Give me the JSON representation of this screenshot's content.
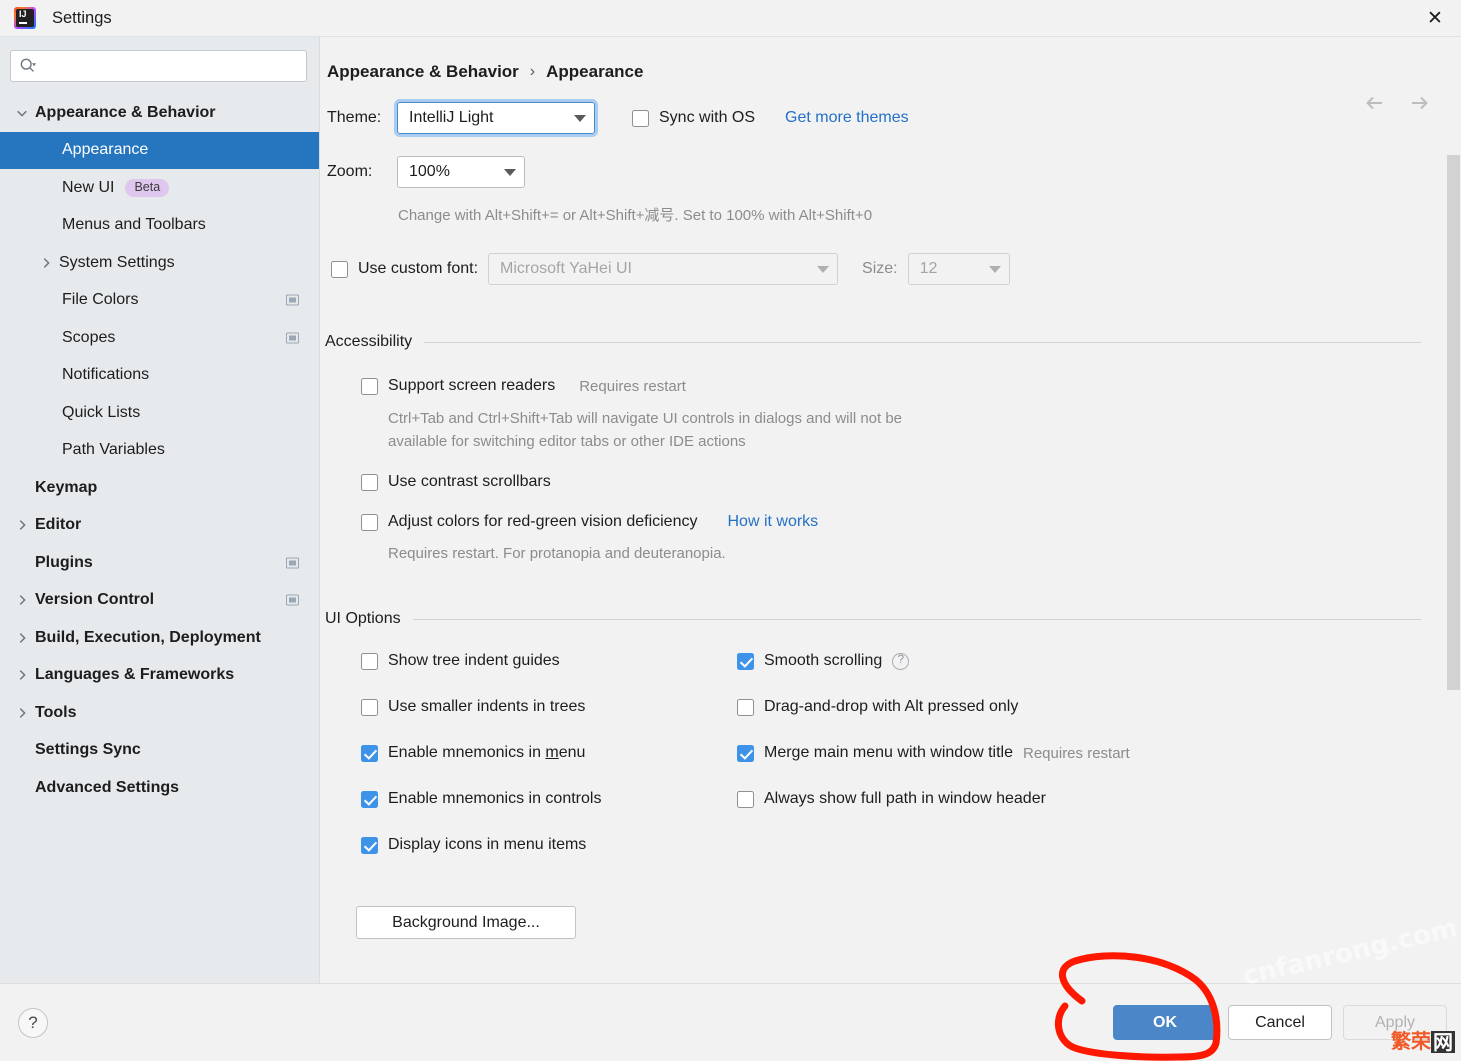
{
  "window": {
    "title": "Settings",
    "app_icon": "intellij-idea-icon",
    "close_icon": "close-icon"
  },
  "sidebar": {
    "search": {
      "value": "",
      "placeholder": "",
      "icon": "search-icon"
    },
    "items": [
      {
        "label": "Appearance & Behavior",
        "level": 0,
        "bold": true,
        "arrow": "down",
        "selected": false,
        "badge": "",
        "proj": false
      },
      {
        "label": "Appearance",
        "level": 1,
        "bold": false,
        "arrow": "",
        "selected": true,
        "badge": "",
        "proj": false
      },
      {
        "label": "New UI",
        "level": 1,
        "bold": false,
        "arrow": "",
        "selected": false,
        "badge": "Beta",
        "proj": false
      },
      {
        "label": "Menus and Toolbars",
        "level": 1,
        "bold": false,
        "arrow": "",
        "selected": false,
        "badge": "",
        "proj": false
      },
      {
        "label": "System Settings",
        "level": 1,
        "bold": false,
        "arrow": "right",
        "selected": false,
        "badge": "",
        "proj": false
      },
      {
        "label": "File Colors",
        "level": 1,
        "bold": false,
        "arrow": "",
        "selected": false,
        "badge": "",
        "proj": true
      },
      {
        "label": "Scopes",
        "level": 1,
        "bold": false,
        "arrow": "",
        "selected": false,
        "badge": "",
        "proj": true
      },
      {
        "label": "Notifications",
        "level": 1,
        "bold": false,
        "arrow": "",
        "selected": false,
        "badge": "",
        "proj": false
      },
      {
        "label": "Quick Lists",
        "level": 1,
        "bold": false,
        "arrow": "",
        "selected": false,
        "badge": "",
        "proj": false
      },
      {
        "label": "Path Variables",
        "level": 1,
        "bold": false,
        "arrow": "",
        "selected": false,
        "badge": "",
        "proj": false
      },
      {
        "label": "Keymap",
        "level": 0,
        "bold": true,
        "arrow": "",
        "selected": false,
        "badge": "",
        "proj": false
      },
      {
        "label": "Editor",
        "level": 0,
        "bold": true,
        "arrow": "right",
        "selected": false,
        "badge": "",
        "proj": false
      },
      {
        "label": "Plugins",
        "level": 0,
        "bold": true,
        "arrow": "",
        "selected": false,
        "badge": "",
        "proj": true
      },
      {
        "label": "Version Control",
        "level": 0,
        "bold": true,
        "arrow": "right",
        "selected": false,
        "badge": "",
        "proj": true
      },
      {
        "label": "Build, Execution, Deployment",
        "level": 0,
        "bold": true,
        "arrow": "right",
        "selected": false,
        "badge": "",
        "proj": false
      },
      {
        "label": "Languages & Frameworks",
        "level": 0,
        "bold": true,
        "arrow": "right",
        "selected": false,
        "badge": "",
        "proj": false
      },
      {
        "label": "Tools",
        "level": 0,
        "bold": true,
        "arrow": "right",
        "selected": false,
        "badge": "",
        "proj": false
      },
      {
        "label": "Settings Sync",
        "level": 0,
        "bold": true,
        "arrow": "",
        "selected": false,
        "badge": "",
        "proj": false
      },
      {
        "label": "Advanced Settings",
        "level": 0,
        "bold": true,
        "arrow": "",
        "selected": false,
        "badge": "",
        "proj": false
      }
    ]
  },
  "main": {
    "breadcrumb": {
      "parent": "Appearance & Behavior",
      "separator": "›",
      "current": "Appearance"
    },
    "nav": {
      "back_icon": "arrow-left-icon",
      "forward_icon": "arrow-right-icon"
    },
    "theme": {
      "label": "Theme:",
      "value": "IntelliJ Light",
      "sync_label": "Sync with OS",
      "sync_checked": false,
      "more_themes_link": "Get more themes"
    },
    "zoom": {
      "label": "Zoom:",
      "value": "100%",
      "hint": "Change with Alt+Shift+= or Alt+Shift+减号. Set to 100% with Alt+Shift+0"
    },
    "custom_font": {
      "label": "Use custom font:",
      "checked": false,
      "font_value": "Microsoft YaHei UI",
      "size_label": "Size:",
      "size_value": "12"
    },
    "accessibility": {
      "title": "Accessibility",
      "screen_readers": {
        "label": "Support screen readers",
        "note": "Requires restart",
        "checked": false
      },
      "screen_readers_desc_1": "Ctrl+Tab and Ctrl+Shift+Tab will navigate UI controls in dialogs and will not be",
      "screen_readers_desc_2": "available for switching editor tabs or other IDE actions",
      "contrast_scrollbars": {
        "label": "Use contrast scrollbars",
        "checked": false
      },
      "red_green": {
        "label": "Adjust colors for red-green vision deficiency",
        "checked": false,
        "link": "How it works"
      },
      "red_green_desc": "Requires restart. For protanopia and deuteranopia."
    },
    "ui_options": {
      "title": "UI Options",
      "left": [
        {
          "label": "Show tree indent guides",
          "checked": false,
          "mnemonic": ""
        },
        {
          "label": "Use smaller indents in trees",
          "checked": false,
          "mnemonic": ""
        },
        {
          "label": "Enable mnemonics in menu",
          "checked": true,
          "mnemonic": "m"
        },
        {
          "label": "Enable mnemonics in controls",
          "checked": true,
          "mnemonic": ""
        },
        {
          "label": "Display icons in menu items",
          "checked": true,
          "mnemonic": ""
        }
      ],
      "right": [
        {
          "label": "Smooth scrolling",
          "checked": true,
          "help": true,
          "note": ""
        },
        {
          "label": "Drag-and-drop with Alt pressed only",
          "checked": false,
          "help": false,
          "note": ""
        },
        {
          "label": "Merge main menu with window title",
          "checked": true,
          "help": false,
          "note": "Requires restart"
        },
        {
          "label": "Always show full path in window header",
          "checked": false,
          "help": false,
          "note": ""
        }
      ],
      "background_image_button": "Background Image..."
    }
  },
  "footer": {
    "help_icon": "question-mark-icon",
    "ok": "OK",
    "cancel": "Cancel",
    "apply": "Apply"
  },
  "watermark": {
    "domain": "cnfanrong.com",
    "logo_a": "繁荣",
    "logo_b": "网"
  },
  "colors": {
    "accent": "#2675bf",
    "ok_button": "#4a86c8",
    "link": "#2470c8",
    "checkbox_on": "#3d93e8",
    "annotation": "#ff1800",
    "sidebar_bg": "#e6eaed"
  }
}
